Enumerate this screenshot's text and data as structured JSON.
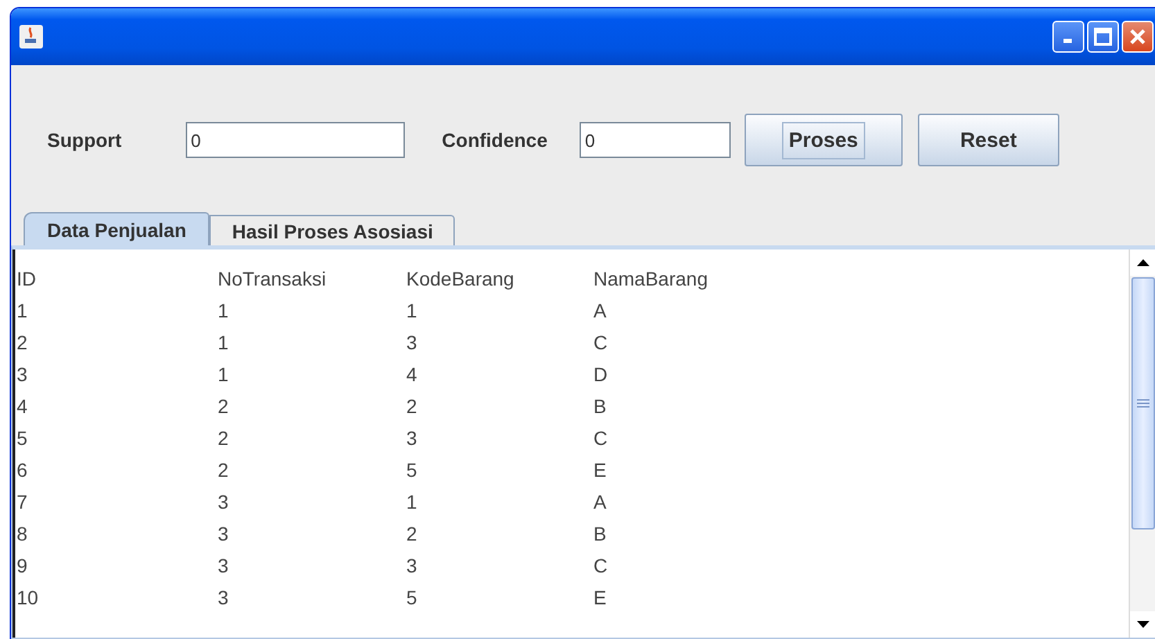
{
  "form": {
    "support_label": "Support",
    "support_value": "0",
    "confidence_label": "Confidence",
    "confidence_value": "0"
  },
  "buttons": [
    {
      "label": "Proses",
      "focused": true
    },
    {
      "label": "Reset",
      "focused": false
    }
  ],
  "tabs": [
    {
      "label": "Data Penjualan",
      "selected": true
    },
    {
      "label": "Hasil Proses Asosiasi",
      "selected": false
    }
  ],
  "table": {
    "columns": [
      "ID",
      "NoTransaksi",
      "KodeBarang",
      "NamaBarang"
    ],
    "rows": [
      [
        "1",
        "1",
        "1",
        "A"
      ],
      [
        "2",
        "1",
        "3",
        "C"
      ],
      [
        "3",
        "1",
        "4",
        "D"
      ],
      [
        "4",
        "2",
        "2",
        "B"
      ],
      [
        "5",
        "2",
        "3",
        "C"
      ],
      [
        "6",
        "2",
        "5",
        "E"
      ],
      [
        "7",
        "3",
        "1",
        "A"
      ],
      [
        "8",
        "3",
        "2",
        "B"
      ],
      [
        "9",
        "3",
        "3",
        "C"
      ],
      [
        "10",
        "3",
        "5",
        "E"
      ]
    ]
  }
}
